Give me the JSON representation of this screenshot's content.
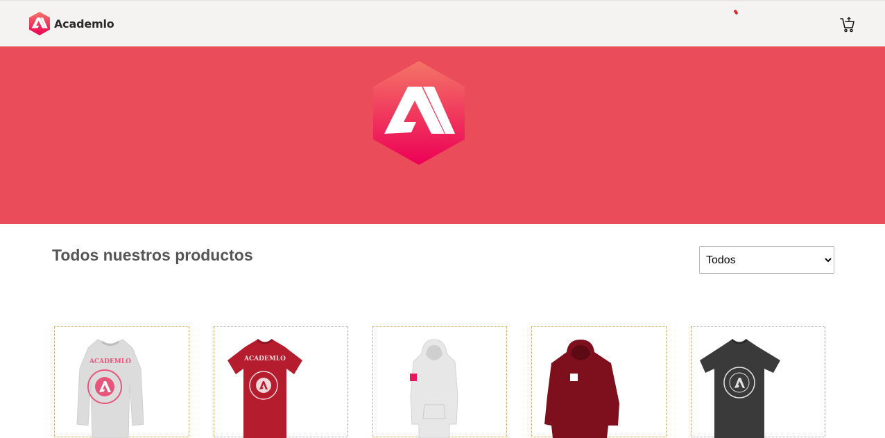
{
  "header": {
    "brand_name": "Academlo",
    "brand_icon": "academlo-logo",
    "cart_icon": "cart-icon"
  },
  "hero": {
    "logo": "academlo-logo-large"
  },
  "products": {
    "title": "Todos nuestros productos",
    "filter": {
      "selected": "Todos",
      "options": [
        "Todos"
      ]
    },
    "items": [
      {
        "image": "sweatshirt-white-academlo"
      },
      {
        "image": "tshirt-red-academlo"
      },
      {
        "image": "hoodie-white-academlo"
      },
      {
        "image": "hoodie-maroon-academlo"
      },
      {
        "image": "tshirt-black-academlo"
      }
    ]
  },
  "colors": {
    "hero_bg": "#ea4c5a",
    "brand_gradient_top": "#f47567",
    "brand_gradient_bottom": "#ec0055",
    "topbar_bg": "#f4f3f1"
  }
}
